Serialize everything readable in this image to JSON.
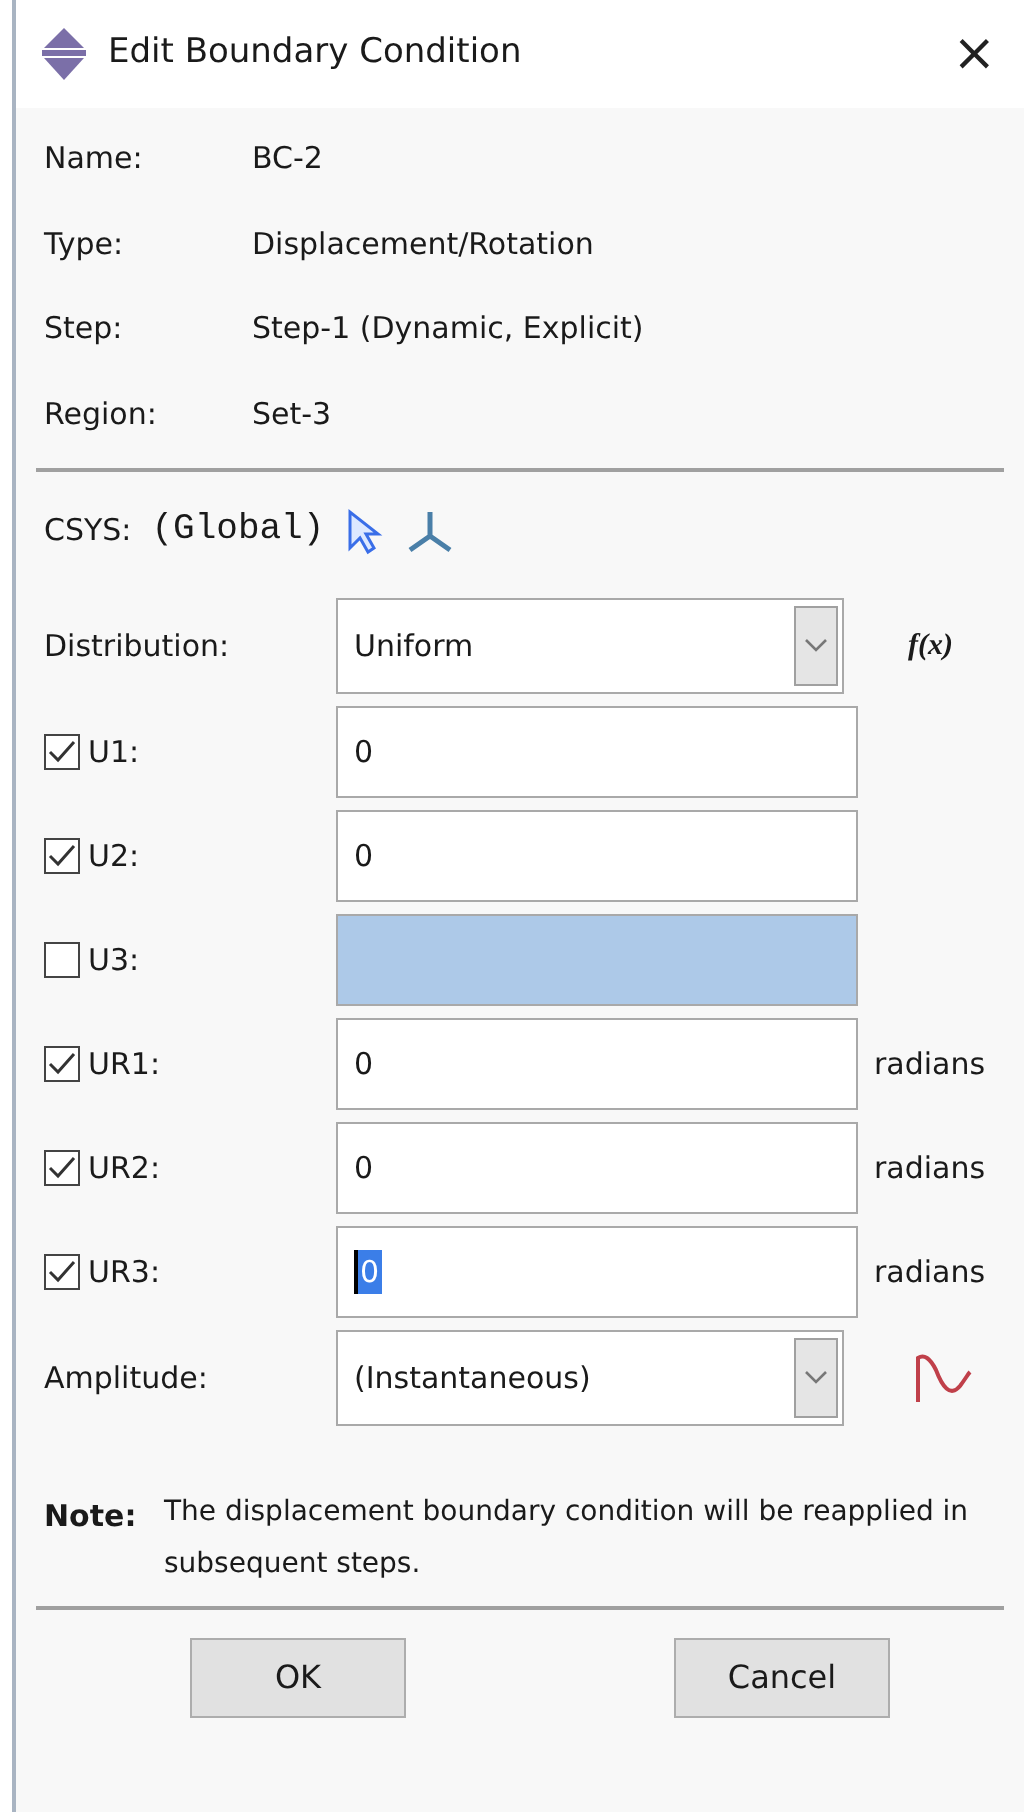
{
  "window": {
    "title": "Edit Boundary Condition",
    "close": "×"
  },
  "info": [
    {
      "label": "Name:",
      "value": "BC-2"
    },
    {
      "label": "Type:",
      "value": "Displacement/Rotation"
    },
    {
      "label": "Step:",
      "value": "Step-1 (Dynamic, Explicit)"
    },
    {
      "label": "Region:",
      "value": "Set-3"
    }
  ],
  "csys": {
    "label": "CSYS:",
    "value": "(Global)"
  },
  "distribution": {
    "label": "Distribution:",
    "value": "Uniform",
    "function_label": "f(x)"
  },
  "components": [
    {
      "label": "U1:",
      "checked": true,
      "value": "0"
    },
    {
      "label": "U2:",
      "checked": true,
      "value": "0"
    },
    {
      "label": "U3:",
      "checked": false
    },
    {
      "label": "UR1:",
      "checked": true,
      "value": "0",
      "unit": "radians"
    },
    {
      "label": "UR2:",
      "checked": true,
      "value": "0",
      "unit": "radians"
    },
    {
      "label": "UR3:",
      "checked": true,
      "value": "0",
      "unit": "radians",
      "text_selected": true
    }
  ],
  "amplitude": {
    "label": "Amplitude:",
    "value": "(Instantaneous)"
  },
  "note": {
    "label": "Note:",
    "text": "The displacement boundary condition will be reapplied in subsequent steps."
  },
  "buttons": [
    "OK",
    "Cancel"
  ]
}
